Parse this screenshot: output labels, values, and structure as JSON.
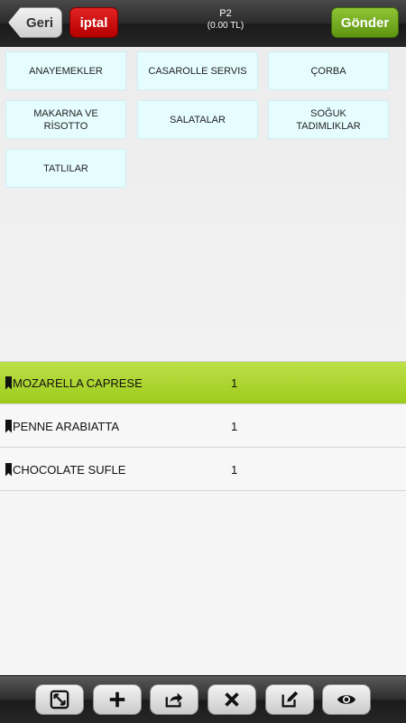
{
  "header": {
    "back_label": "Geri",
    "cancel_label": "iptal",
    "table_name": "P2",
    "total": "(0.00 TL)",
    "send_label": "Gönder"
  },
  "categories": [
    {
      "label": "ANAYEMEKLER"
    },
    {
      "label": "CASAROLLE SERVIS"
    },
    {
      "label": "ÇORBA"
    },
    {
      "label": "MAKARNA VE\nRİSOTTO"
    },
    {
      "label": "SALATALAR"
    },
    {
      "label": "SOĞUK\nTADIMLIKLAR"
    },
    {
      "label": "TATLILAR"
    }
  ],
  "orders": [
    {
      "name": "MOZARELLA CAPRESE",
      "qty": "1",
      "selected": true
    },
    {
      "name": "PENNE ARABIATTA",
      "qty": "1",
      "selected": false
    },
    {
      "name": "CHOCOLATE SUFLE",
      "qty": "1",
      "selected": false
    }
  ],
  "toolbar": {
    "buttons": [
      "expand-icon",
      "plus-icon",
      "share-icon",
      "delete-icon",
      "edit-icon",
      "eye-icon"
    ]
  },
  "colors": {
    "send": "#6fa81e",
    "cancel": "#c80000",
    "selected_row": "#a8d22c",
    "category_bg": "#e6fdff"
  }
}
